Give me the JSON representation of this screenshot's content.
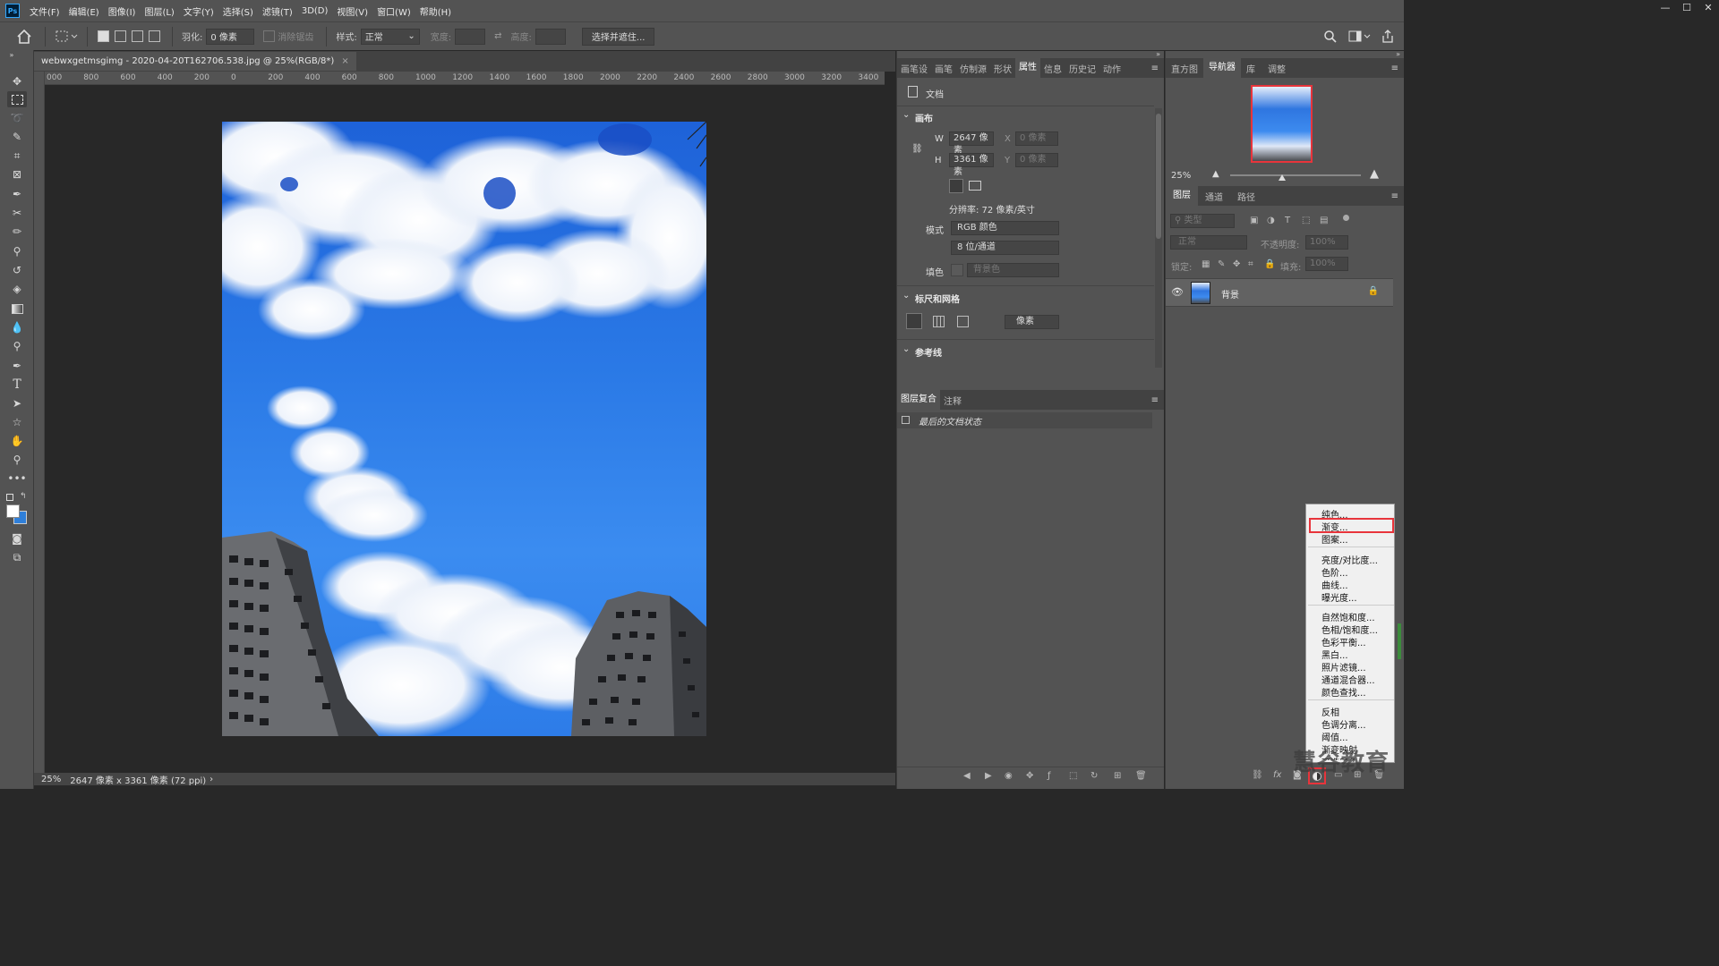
{
  "app": {
    "logo": "Ps"
  },
  "menubar": {
    "items": [
      "文件(F)",
      "编辑(E)",
      "图像(I)",
      "图层(L)",
      "文字(Y)",
      "选择(S)",
      "滤镜(T)",
      "3D(D)",
      "视图(V)",
      "窗口(W)",
      "帮助(H)"
    ]
  },
  "window_controls": {
    "minimize": "—",
    "maximize": "☐",
    "close": "✕"
  },
  "options": {
    "feather_label": "羽化:",
    "feather_value": "0 像素",
    "antialias_label": "消除锯齿",
    "style_label": "样式:",
    "style_value": "正常",
    "width_label": "宽度:",
    "height_label": "高度:",
    "select_mask_button": "选择并遮住..."
  },
  "document": {
    "tab_title": "webwxgetmsgimg - 2020-04-20T162706.538.jpg @ 25%(RGB/8*)",
    "tab_close": "×"
  },
  "ruler": {
    "h_labels": [
      "000",
      "800",
      "600",
      "400",
      "200",
      "0",
      "200",
      "400",
      "600",
      "800",
      "1000",
      "1200",
      "1400",
      "1600",
      "1800",
      "2000",
      "2200",
      "2400",
      "2600",
      "2800",
      "3000",
      "3200",
      "3400"
    ]
  },
  "status": {
    "zoom": "25%",
    "info": "2647 像素 x 3361 像素 (72 ppi)",
    "arrow": "›"
  },
  "properties": {
    "tabs": [
      "画笔设",
      "画笔",
      "仿制源",
      "形状",
      "属性",
      "信息",
      "历史记",
      "动作"
    ],
    "active_tab": "属性",
    "doc_label": "文档",
    "canvas_section": "画布",
    "w_label": "W",
    "w_value": "2647 像素",
    "h_label": "H",
    "h_value": "3361 像素",
    "x_label": "X",
    "x_value": "0 像素",
    "y_label": "Y",
    "y_value": "0 像素",
    "resolution": "分辨率: 72 像素/英寸",
    "mode_label": "模式",
    "mode_value": "RGB 颜色",
    "depth_value": "8 位/通道",
    "fill_label": "填色",
    "fill_value": "背景色",
    "rulers_section": "标尺和网格",
    "units_value": "像素",
    "guides_section": "参考线"
  },
  "layer_comps": {
    "tabs": [
      "图层复合",
      "注释"
    ],
    "item": "最后的文档状态"
  },
  "navigator": {
    "tabs": [
      "直方图",
      "导航器",
      "库",
      "调整"
    ],
    "active_tab": "导航器",
    "zoom": "25%"
  },
  "layers": {
    "tabs": [
      "图层",
      "通道",
      "路径"
    ],
    "active_tab": "图层",
    "filter_placeholder": "类型",
    "blend_mode": "正常",
    "opacity_label": "不透明度:",
    "opacity_value": "100%",
    "lock_label": "锁定:",
    "fill_label": "填充:",
    "fill_value": "100%",
    "layer_name": "背景"
  },
  "adjust_menu": {
    "group1": [
      "纯色...",
      "渐变...",
      "图案..."
    ],
    "group2": [
      "亮度/对比度...",
      "色阶...",
      "曲线...",
      "曝光度..."
    ],
    "group3": [
      "自然饱和度...",
      "色相/饱和度...",
      "色彩平衡...",
      "黑白...",
      "照片滤镜...",
      "通道混合器...",
      "颜色查找..."
    ],
    "group4": [
      "反相",
      "色调分离...",
      "阈值...",
      "渐变映射",
      "可选颜色..."
    ],
    "highlighted": "渐变..."
  },
  "watermark": "慧谷教育",
  "colors": {
    "accent": "#e8343b",
    "panel": "#535353",
    "dark": "#282828"
  }
}
